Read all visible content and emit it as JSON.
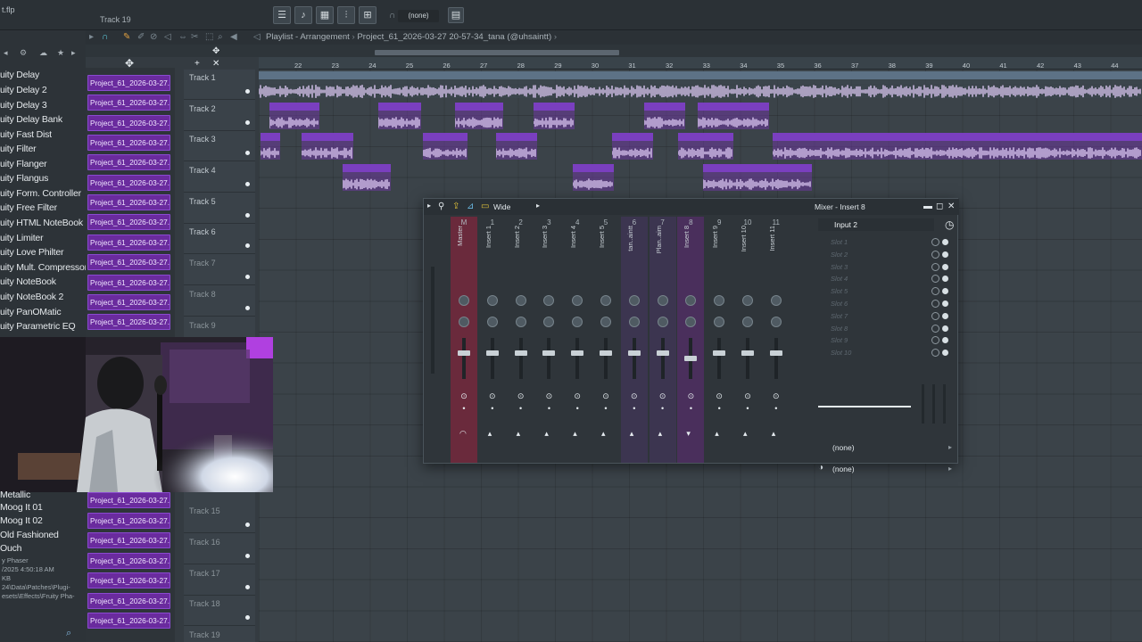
{
  "top": {
    "file_name": "t.flp",
    "hint_track": "Track 19",
    "pattern_selector": "(none)",
    "hint_label": "ser"
  },
  "browser": {
    "items": [
      "uity Delay",
      "uity Delay 2",
      "uity Delay 3",
      "uity Delay Bank",
      "uity Fast Dist",
      "uity Filter",
      "uity Flanger",
      "uity Flangus",
      "uity Form. Controller",
      "uity Free Filter",
      "uity HTML NoteBook",
      "uity Limiter",
      "uity Love Philter",
      "uity Mult. Compressor",
      "uity NoteBook",
      "uity NoteBook 2",
      "uity PanOMatic",
      "uity Parametric EQ"
    ],
    "items_bottom": [
      "Metallic",
      "Moog It 01",
      "Moog It 02",
      "Old Fashioned",
      "Ouch"
    ],
    "info_lines": [
      "y Phaser",
      "/2025 4:50:18 AM",
      "KB",
      "24\\Data\\Patches\\Plugi-",
      "esets\\Effects\\Fruity Pha-"
    ]
  },
  "picker": {
    "clip_label": "Project_61_2026-03-27..."
  },
  "playlist": {
    "title": "Playlist - Arrangement",
    "project_path": "Project_61_2026-03-27 20-57-34_tana (@uhsaintt)",
    "ruler": [
      "22",
      "23",
      "24",
      "25",
      "26",
      "27",
      "28",
      "29",
      "30",
      "31",
      "32",
      "33",
      "34",
      "35",
      "36",
      "37",
      "38",
      "39",
      "40",
      "41",
      "42",
      "43",
      "44"
    ],
    "tracks": [
      "Track 1",
      "Track 2",
      "Track 3",
      "Track 4",
      "Track 5",
      "Track 6",
      "Track 7",
      "Track 8",
      "Track 9",
      "Track 15",
      "Track 16",
      "Track 17",
      "Track 18",
      "Track 19"
    ],
    "master_clip_label": "PAMELA BKTHERULA x Pyro 25 x Tovi Type Beat 2026",
    "clips": {
      "t2": [
        "untitl..saintt)",
        "Proje..intt)",
        "Proje..aintt)",
        "Proj..intt)",
        "Proje..intt)",
        "Project_61..(@uhsaintt)"
      ],
      "t3": [
        "untitl..saintt)",
        "Proje..intt)",
        "Proje..intt)",
        "Proj..intt)",
        "Project..saintt)",
        "Project_61_2026-03-28 05-48-58_tana (@uhsaintt)"
      ],
      "t4": [
        "untitl..saintt)",
        "Proj..intt)",
        "Project_61_202..ana (@uhsaintt)"
      ]
    }
  },
  "mixer": {
    "title": "Mixer - Insert 8",
    "mode": "Wide",
    "channels": [
      "Master",
      "Insert 1",
      "Insert 2",
      "Insert 3",
      "Insert 4",
      "Insert 5",
      "tan..aintt",
      "Plan..aim",
      "Insert 8",
      "Insert 9",
      "Insert 10",
      "Insert 11"
    ],
    "channel_numbers": [
      "M",
      "1",
      "2",
      "3",
      "4",
      "5",
      "6",
      "7",
      "8",
      "9",
      "10",
      "11"
    ],
    "input": "Input 2",
    "slots": [
      "Slot 1",
      "Slot 2",
      "Slot 3",
      "Slot 4",
      "Slot 5",
      "Slot 6",
      "Slot 7",
      "Slot 8",
      "Slot 9",
      "Slot 10"
    ],
    "output_1": "(none)",
    "output_2": "(none)"
  },
  "colors": {
    "clip": "#7a3fbf",
    "master_strip": "#6a2a3c",
    "selected_strip": "#4a2f5c"
  }
}
